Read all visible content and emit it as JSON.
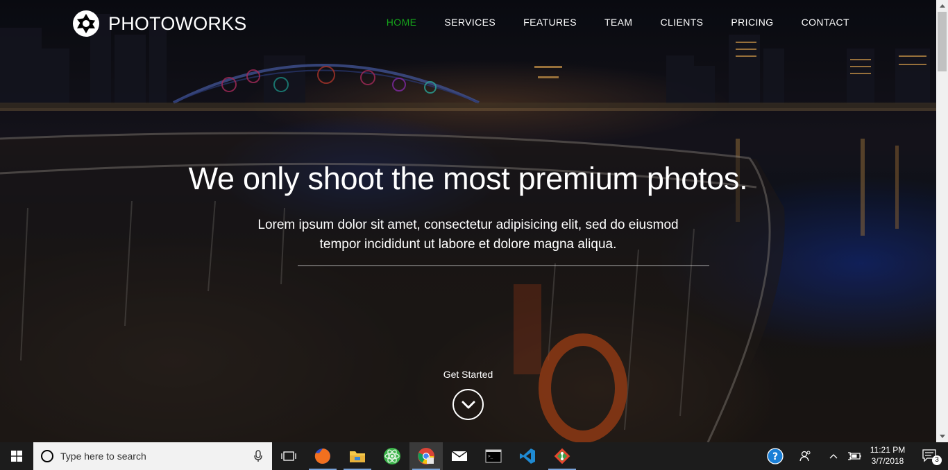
{
  "site": {
    "brand": "PHOTOWORKS",
    "nav": [
      {
        "label": "HOME",
        "active": true
      },
      {
        "label": "SERVICES",
        "active": false
      },
      {
        "label": "FEATURES",
        "active": false
      },
      {
        "label": "TEAM",
        "active": false
      },
      {
        "label": "CLIENTS",
        "active": false
      },
      {
        "label": "PRICING",
        "active": false
      },
      {
        "label": "CONTACT",
        "active": false
      }
    ],
    "hero": {
      "title": "We only shoot the most premium photos.",
      "subtitle_line1": "Lorem ipsum dolor sit amet, consectetur adipisicing elit, sed do eiusmod",
      "subtitle_line2": "tempor incididunt ut labore et dolore magna aliqua.",
      "cta_label": "Get Started",
      "cta_icon": "chevron-down-icon"
    },
    "colors": {
      "accent": "#15a51a",
      "text": "#ffffff"
    }
  },
  "taskbar": {
    "search_placeholder": "Type here to search",
    "apps": [
      {
        "name": "task-view-icon"
      },
      {
        "name": "firefox-icon"
      },
      {
        "name": "file-explorer-icon"
      },
      {
        "name": "atom-icon"
      },
      {
        "name": "chrome-icon"
      },
      {
        "name": "mail-icon"
      },
      {
        "name": "terminal-icon"
      },
      {
        "name": "vscode-icon"
      },
      {
        "name": "sourcetree-icon"
      }
    ],
    "clock_time": "11:21 PM",
    "clock_date": "3/7/2018",
    "notification_count": "3"
  }
}
